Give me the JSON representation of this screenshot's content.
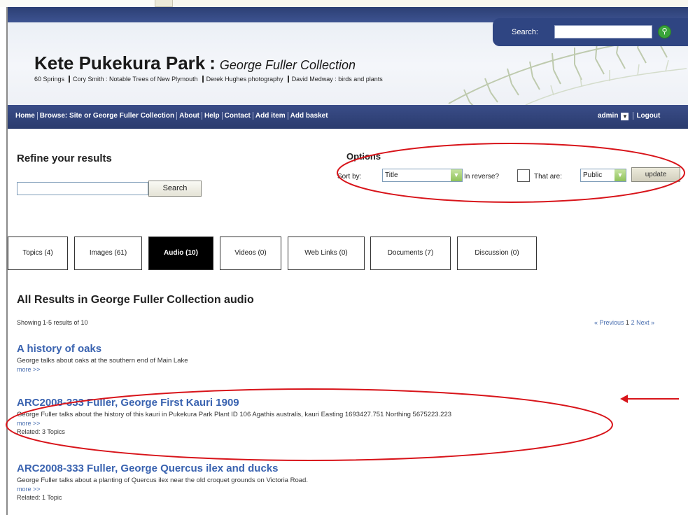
{
  "header": {
    "search_label": "Search:",
    "search_value": "",
    "site_title": "Kete Pukekura Park",
    "title_separator": ":",
    "collection_title": "George Fuller Collection",
    "subsites": [
      "60 Springs",
      "Cory Smith : Notable Trees of New Plymouth",
      "Derek Hughes photography",
      "David Medway : birds and plants"
    ]
  },
  "nav": {
    "links": [
      "Home",
      "Browse: Site or George Fuller Collection",
      "About",
      "Help",
      "Contact",
      "Add item",
      "Add basket"
    ],
    "user": "admin",
    "logout": "Logout"
  },
  "refine": {
    "heading": "Refine your results",
    "input_value": "",
    "button": "Search"
  },
  "options": {
    "heading": "Options",
    "sort_label": "Sort by:",
    "sort_value": "Title",
    "reverse_label": "In reverse?",
    "reverse_checked": false,
    "that_are_label": "That are:",
    "that_are_value": "Public",
    "update_button": "update"
  },
  "tabs": [
    {
      "label": "Topics (4)",
      "active": false
    },
    {
      "label": "Images (61)",
      "active": false
    },
    {
      "label": "Audio (10)",
      "active": true
    },
    {
      "label": "Videos (0)",
      "active": false
    },
    {
      "label": "Web Links (0)",
      "active": false
    },
    {
      "label": "Documents (7)",
      "active": false
    },
    {
      "label": "Discussion (0)",
      "active": false
    }
  ],
  "results": {
    "heading": "All Results in George Fuller Collection audio",
    "showing": "Showing 1-5 results of 10",
    "pager": {
      "previous": "« Previous",
      "current": "1",
      "page2": "2",
      "next": "Next »"
    },
    "items": [
      {
        "title": "A history of oaks",
        "desc": "George talks about oaks at the southern end of Main Lake",
        "more": "more >>",
        "related": ""
      },
      {
        "title": "ARC2008-333 Fuller, George First Kauri 1909",
        "desc": "George Fuller talks about the history of this kauri in Pukekura Park Plant ID 106 Agathis australis, kauri Easting 1693427.751 Northing 5675223.223",
        "more": "more >>",
        "related": "Related: 3 Topics"
      },
      {
        "title": "ARC2008-333 Fuller, George Quercus ilex and ducks",
        "desc": "George Fuller talks about a planting of Quercus ilex near the old croquet grounds on Victoria Road.",
        "more": "more >>",
        "related": "Related: 1 Topic"
      }
    ]
  },
  "colors": {
    "annotation": "#d8141a",
    "nav_bg": "#2f4582",
    "link": "#3a63b0"
  }
}
